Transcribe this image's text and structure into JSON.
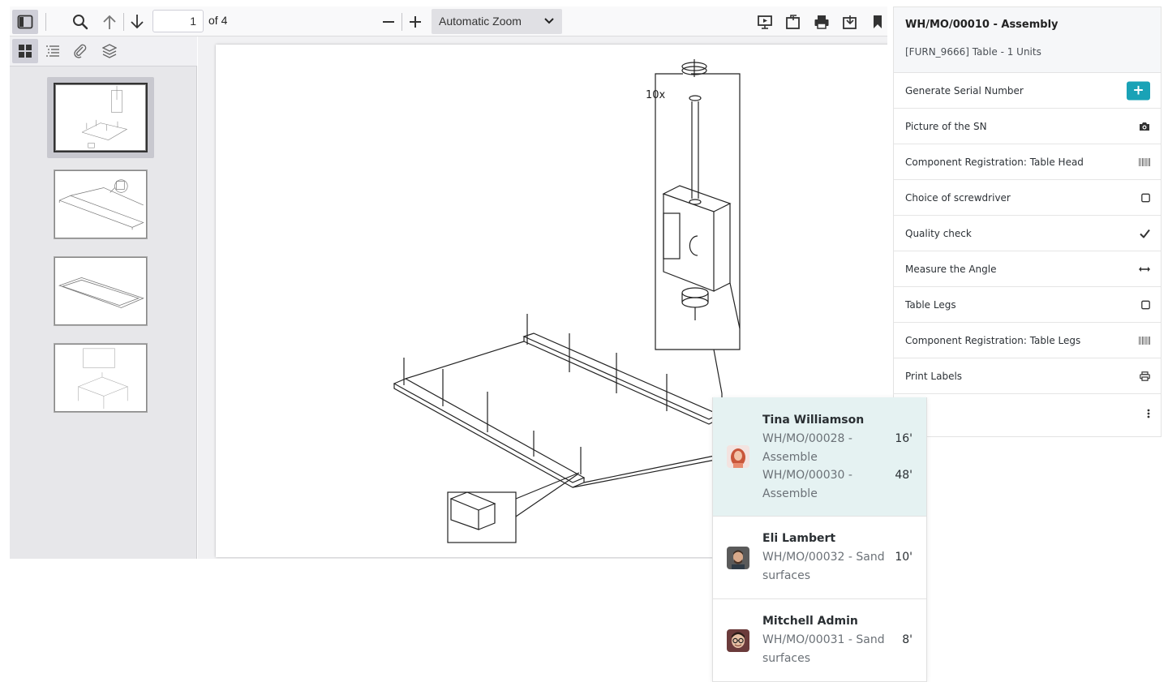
{
  "viewer": {
    "page_number": "1",
    "page_count": "of 4",
    "zoom": "Automatic Zoom",
    "thumbnails": [
      {
        "page": "1",
        "selected": true
      },
      {
        "page": "2",
        "selected": false
      },
      {
        "page": "3",
        "selected": false
      },
      {
        "page": "4",
        "selected": false
      }
    ],
    "drawing_annotation": "10x"
  },
  "worksheet": {
    "title": "WH/MO/00010 - Assembly",
    "subtitle": "[FURN_9666] Table - 1 Units",
    "steps": [
      {
        "label": "Generate Serial Number",
        "icon": "plus-icon"
      },
      {
        "label": "Picture of the SN",
        "icon": "camera-icon"
      },
      {
        "label": "Component Registration: Table Head",
        "icon": "barcode-icon"
      },
      {
        "label": "Choice of screwdriver",
        "icon": "checkbox-icon"
      },
      {
        "label": "Quality check",
        "icon": "check-icon"
      },
      {
        "label": "Measure the Angle",
        "icon": "arrows-h-icon"
      },
      {
        "label": "Table Legs",
        "icon": "checkbox-icon"
      },
      {
        "label": "Component Registration: Table Legs",
        "icon": "barcode-icon"
      },
      {
        "label": "Print Labels",
        "icon": "print-icon"
      }
    ],
    "menu_icon": "kebab-menu-icon",
    "accent": "#1aa2b6"
  },
  "employees": [
    {
      "name": "Tina Williamson",
      "orders": [
        {
          "label": "WH/MO/00028 - Assemble",
          "duration": "16'"
        },
        {
          "label": "WH/MO/00030 - Assemble",
          "duration": "48'"
        }
      ]
    },
    {
      "name": "Eli Lambert",
      "orders": [
        {
          "label": "WH/MO/00032 - Sand surfaces",
          "duration": "10'"
        }
      ]
    },
    {
      "name": "Mitchell Admin",
      "orders": [
        {
          "label": "WH/MO/00031 - Sand surfaces",
          "duration": "8'"
        }
      ]
    }
  ]
}
